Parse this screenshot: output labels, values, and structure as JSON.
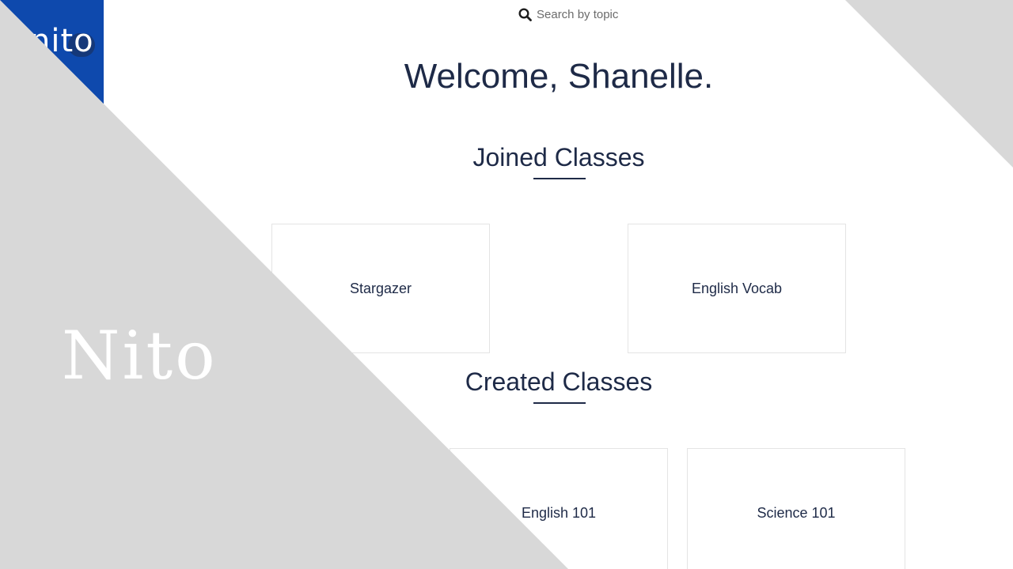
{
  "logo": {
    "text": "nito"
  },
  "search": {
    "placeholder": "Search by topic",
    "icon": "search-icon"
  },
  "welcome": "Welcome, Shanelle.",
  "joined": {
    "title": "Joined Classes",
    "classes": [
      "Stargazer",
      "English Vocab"
    ]
  },
  "created": {
    "title": "Created Classes",
    "classes": [
      "English 101",
      "Science 101"
    ]
  },
  "brand": {
    "word": "Nito"
  },
  "colors": {
    "brand_blue": "#0e49ad",
    "heading": "#1e2a47",
    "overlay_gray": "#d8d8d8"
  }
}
